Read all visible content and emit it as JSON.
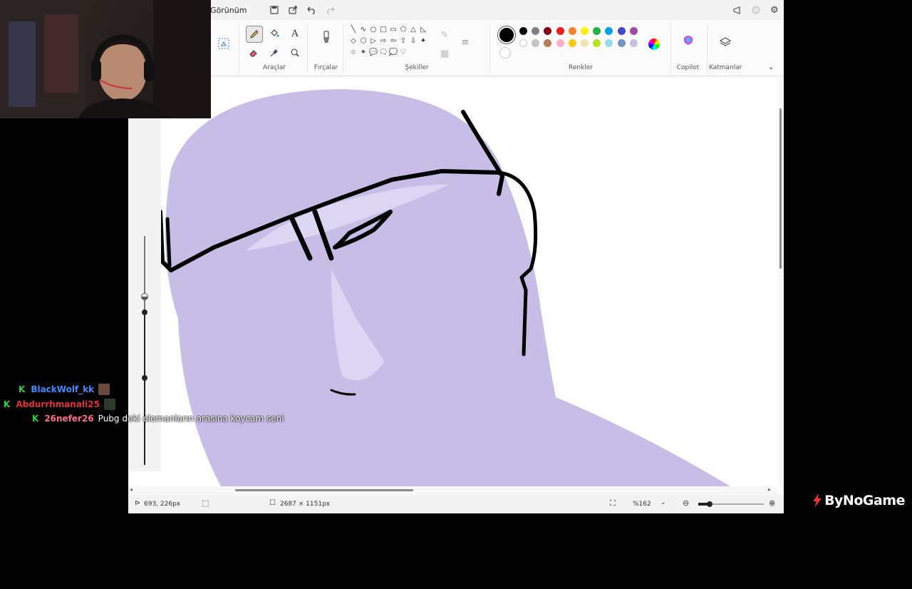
{
  "app": {
    "menu_label": "Görünüm"
  },
  "ribbon": {
    "groups": {
      "tools": "Araçlar",
      "brushes": "Fırçalar",
      "shapes": "Şekiller",
      "colors": "Renkler",
      "copilot": "Copilot",
      "layers": "Katmanlar"
    },
    "shape_glyphs": [
      "╲",
      "∿",
      "○",
      "□",
      "▭",
      "⬠",
      "△",
      "◺",
      "◇",
      "⬡",
      "▷",
      "⇨",
      "⇦",
      "⇧",
      "⇩",
      "✦",
      "☆",
      "✶",
      "💬",
      "🗨",
      "💭",
      "♡"
    ],
    "palette_row1": [
      "#000000",
      "#7f7f7f",
      "#880015",
      "#ed1c24",
      "#ff7f27",
      "#fff200",
      "#22b14c",
      "#00a2e8",
      "#3f48cc",
      "#a349a4"
    ],
    "palette_row2": [
      "#ffffff",
      "#c3c3c3",
      "#b97a57",
      "#ffaec9",
      "#ffc90e",
      "#efe4b0",
      "#b5e61d",
      "#99d9ea",
      "#7092be",
      "#c8bfe7"
    ],
    "primary_color": "#000000",
    "secondary_color": "#ffffff"
  },
  "canvas": {
    "fill_color": "#c7bde6",
    "highlight_color": "#ddd6f3",
    "stroke_color": "#000000"
  },
  "statusbar": {
    "cursor_position": "693, 226px",
    "canvas_size": "2687 × 1151px",
    "zoom": "%162"
  },
  "chat": {
    "messages": [
      {
        "user": "BlackWolf_kk",
        "color": "#3f8cff",
        "text": ""
      },
      {
        "user": "Abdurrhmanali25",
        "color": "#e0303a",
        "text": ""
      },
      {
        "user": "26nefer26",
        "color": "#ff6a8a",
        "text": "Pubg deki elemanların arasına koycam seni"
      }
    ]
  },
  "brand": {
    "name": "ByNoGame",
    "color": "#ffffff"
  }
}
